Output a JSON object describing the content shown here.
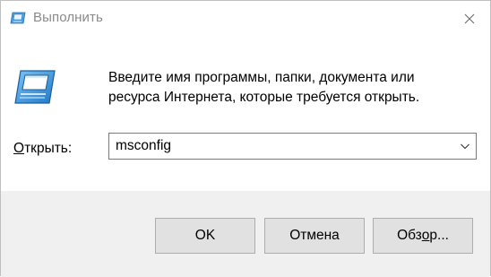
{
  "window": {
    "title": "Выполнить",
    "title_icon": "run-app-icon",
    "close_icon": "close-icon"
  },
  "content": {
    "icon": "run-app-icon",
    "description_line1": "Введите имя программы, папки, документа или",
    "description_line2": "ресурса Интернета, которые требуется открыть.",
    "open_label_accel": "О",
    "open_label_rest": "ткрыть:",
    "open_value": "msconfig",
    "dropdown_icon": "chevron-down-icon"
  },
  "buttons": {
    "ok": "OK",
    "cancel": "Отмена",
    "browse_pre": "Обз",
    "browse_accel": "о",
    "browse_post": "р..."
  },
  "colors": {
    "title_text": "#8a8a8a",
    "footer_bg": "#f0f0f0",
    "button_bg": "#e1e1e1",
    "button_border": "#adadad",
    "icon_blue": "#2b88d8"
  }
}
